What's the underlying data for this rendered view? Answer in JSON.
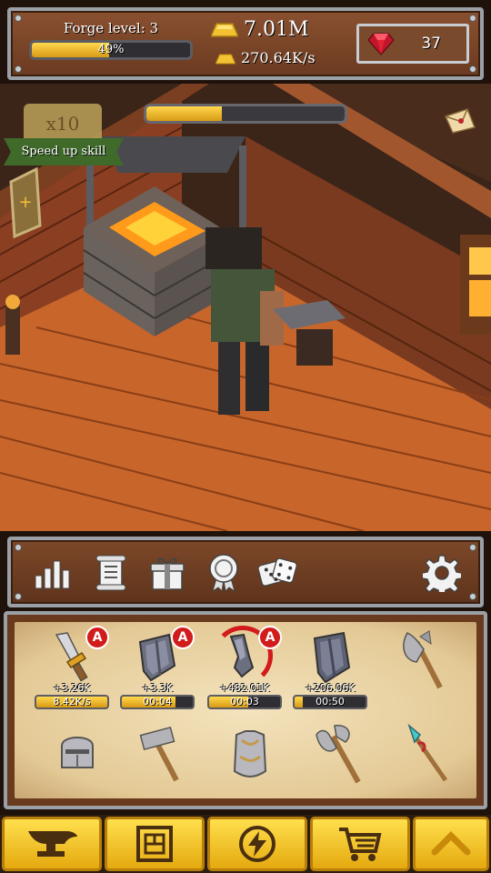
{
  "hud": {
    "forge_label": "Forge level: 3",
    "forge_progress_text": "49%",
    "forge_progress": 0.49,
    "gold_total": "7.01M",
    "gold_rate": "270.64K/s",
    "gems": "37"
  },
  "scene": {
    "craft_progress": 0.38,
    "speed_multiplier": "x10",
    "speed_label": "Speed up skill"
  },
  "menu": {
    "icons": [
      "stats-icon",
      "scroll-icon",
      "gift-icon",
      "achievement-medal-icon",
      "dice-icon",
      "settings-gear-icon"
    ]
  },
  "items": [
    {
      "name": "golden-sword",
      "value": "+3.26K",
      "bar_text": "8.42K/s",
      "progress": 1.0,
      "badge": "A",
      "active": true
    },
    {
      "name": "iron-shield",
      "value": "+3.3K",
      "bar_text": "00:04",
      "progress": 0.75,
      "badge": "A",
      "active": true
    },
    {
      "name": "steel-gauntlet",
      "value": "+482.01K",
      "bar_text": "00:03",
      "progress": 0.55,
      "badge": "A",
      "active": true
    },
    {
      "name": "tower-shield",
      "value": "+206.06K",
      "bar_text": "00:50",
      "progress": 0.12,
      "badge": "",
      "active": true
    },
    {
      "name": "battle-axe",
      "active": false
    },
    {
      "name": "knight-helmet",
      "active": false
    },
    {
      "name": "war-hammer",
      "active": false
    },
    {
      "name": "chest-armor",
      "active": false
    },
    {
      "name": "double-axe",
      "active": false
    },
    {
      "name": "crystal-spear",
      "active": false
    }
  ],
  "nav": {
    "icons": [
      "anvil-icon",
      "blueprint-icon",
      "lightning-boost-icon",
      "shop-cart-icon",
      "expand-up-icon"
    ]
  },
  "colors": {
    "gold": "#f2c233",
    "badge_red": "#d21b1b",
    "frame": "#9aa0a6",
    "wood": "#7d4829",
    "parchment": "#f4e3bd"
  }
}
